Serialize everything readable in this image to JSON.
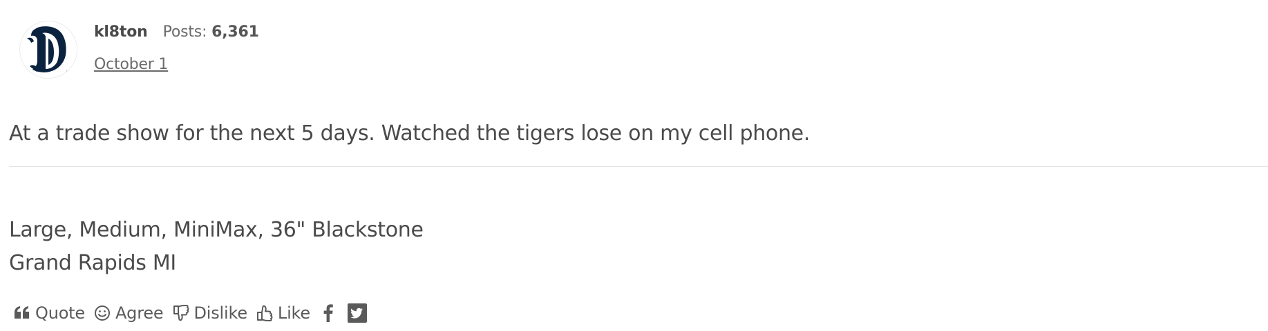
{
  "post": {
    "author": {
      "username": "kl8ton",
      "posts_label": "Posts:",
      "posts_count": "6,361",
      "avatar_icon": "detroit-tigers-old-english-d-logo"
    },
    "date": "October 1",
    "body": "At a trade show for the next 5 days. Watched the tigers lose on my cell phone.",
    "signature": [
      "Large, Medium, MiniMax, 36\" Blackstone",
      "Grand Rapids MI"
    ],
    "actions": {
      "quote": "Quote",
      "agree": "Agree",
      "dislike": "Dislike",
      "like": "Like"
    },
    "share": {
      "facebook_icon": "facebook-icon",
      "twitter_icon": "twitter-icon"
    },
    "colors": {
      "text": "#4a4a4a",
      "muted": "#6b6b6b",
      "logo_navy": "#0c2340",
      "divider": "#e3e3e3"
    }
  }
}
